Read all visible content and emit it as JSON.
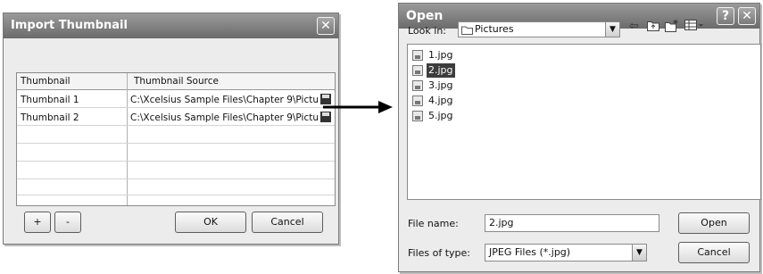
{
  "import_dialog": {
    "title": "Import Thumbnail",
    "close_glyph": "✕",
    "columns": [
      "Thumbnail",
      "Thumbnail Source"
    ],
    "rows": [
      {
        "thumbnail": "Thumbnail 1",
        "source": "C:\\Xcelsius Sample Files\\Chapter 9\\Pictu"
      },
      {
        "thumbnail": "Thumbnail 2",
        "source": "C:\\Xcelsius Sample Files\\Chapter 9\\Pictu"
      }
    ],
    "add_label": "+",
    "remove_label": "-",
    "ok_label": "OK",
    "cancel_label": "Cancel"
  },
  "open_dialog": {
    "title": "Open",
    "help_glyph": "?",
    "close_glyph": "✕",
    "look_in_label": "Look in:",
    "look_in_value": "Pictures",
    "files": [
      "1.jpg",
      "2.jpg",
      "3.jpg",
      "4.jpg",
      "5.jpg"
    ],
    "selected_file": "2.jpg",
    "file_name_label": "File name:",
    "file_name_value": "2.jpg",
    "files_of_type_label": "Files of type:",
    "files_of_type_value": "JPEG Files (*.jpg)",
    "open_label": "Open",
    "cancel_label": "Cancel"
  }
}
